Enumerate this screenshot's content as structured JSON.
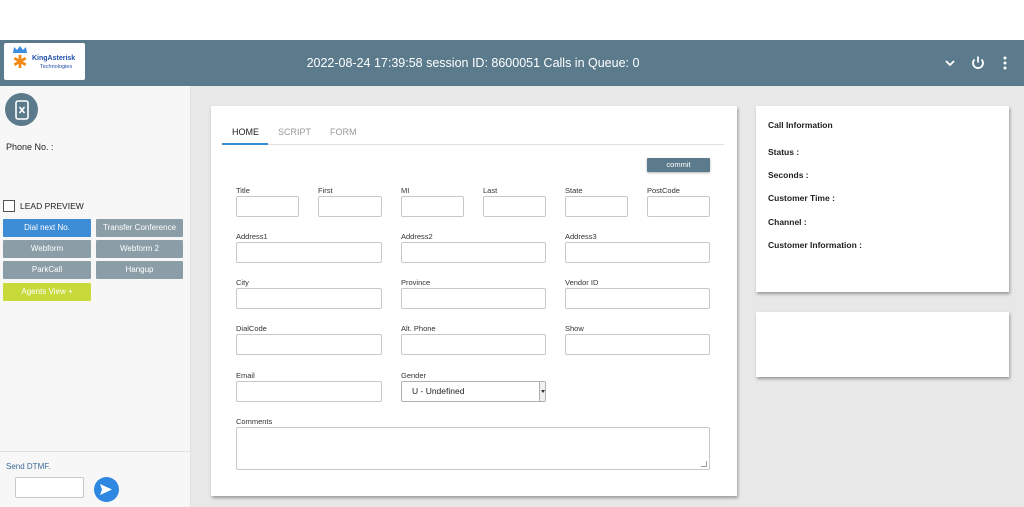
{
  "header": {
    "logo_text_main": "KingAsterisk",
    "logo_text_sub": "Technologies",
    "title": "2022-08-24 17:39:58 session ID: 8600051  Calls in Queue: 0",
    "bg_color": "#5b7b8c"
  },
  "icons": {
    "chevron": "chevron-down-icon",
    "power": "power-icon",
    "menu": "more-vertical-icon"
  },
  "sidebar": {
    "phone_label": "Phone No. :",
    "lead_preview_label": "LEAD PREVIEW",
    "buttons": {
      "dial_next": "Dial next No.",
      "transfer_conference": "Transfer Conference",
      "webform": "Webform",
      "webform2": "Webform 2",
      "park_call": "ParkCall",
      "hangup": "Hangup",
      "agents_view": "Agents View +"
    },
    "dtmf_label": "Send DTMF.",
    "colors": {
      "blue": "#3d8cd6",
      "gray": "#8b9da7",
      "lime": "#c8d93a"
    }
  },
  "form": {
    "tabs": [
      "HOME",
      "SCRIPT",
      "FORM"
    ],
    "active_tab": "HOME",
    "commit_label": "commit",
    "labels": {
      "title": "Title",
      "first": "First",
      "mi": "MI",
      "last": "Last",
      "state": "State",
      "postcode": "PostCode",
      "address1": "Address1",
      "address2": "Address2",
      "address3": "Address3",
      "city": "City",
      "province": "Province",
      "vendor_id": "Vendor ID",
      "dialcode": "DialCode",
      "alt_phone": "Alt. Phone",
      "show": "Show",
      "email": "Email",
      "gender": "Gender",
      "comments": "Comments"
    },
    "gender_value": "U - Undefined"
  },
  "call_info": {
    "title": "Call Information",
    "status": "Status :",
    "seconds": "Seconds :",
    "customer_time": "Customer Time :",
    "channel": "Channel :",
    "customer_information": "Customer Information :"
  }
}
